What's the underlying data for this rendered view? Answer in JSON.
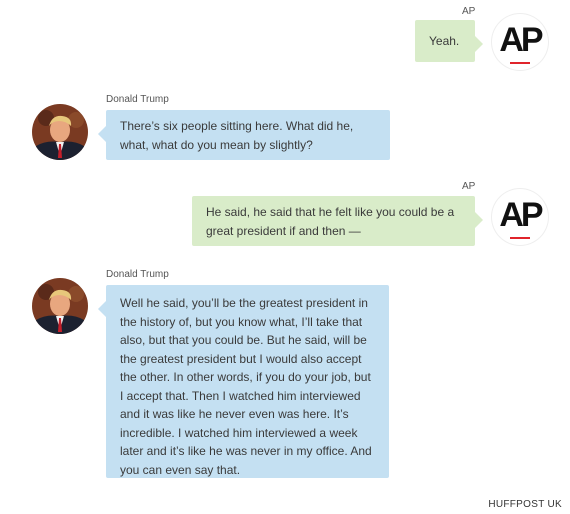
{
  "messages": [
    {
      "speaker": "AP",
      "text": "Yeah."
    },
    {
      "speaker": "Donald Trump",
      "text": "There’s six people sitting here. What did he, what, what do you mean by slightly?"
    },
    {
      "speaker": "AP",
      "text": "He said, he said that he felt like you could be a great president if and then —"
    },
    {
      "speaker": "Donald Trump",
      "text": "Well he said, you’ll be the greatest president in the history of, but you know what, I’ll take that also, but that you could be. But he said, will be the greatest president but I would also accept the other. In other words, if you do your job, but I accept that. Then I watched him interviewed and it was like he never even was here. It’s incredible. I watched him interviewed a week later and it’s like he was never in my office. And you can even say that."
    }
  ],
  "ap_logo_text": "AP",
  "footer": "HUFFPOST UK",
  "colors": {
    "ap_bubble": "#d9ecc9",
    "trump_bubble": "#c4e0f2",
    "ap_logo_red": "#e0242b"
  },
  "icons": {
    "ap_avatar": "ap-logo-icon",
    "trump_avatar": "trump-photo-icon"
  }
}
